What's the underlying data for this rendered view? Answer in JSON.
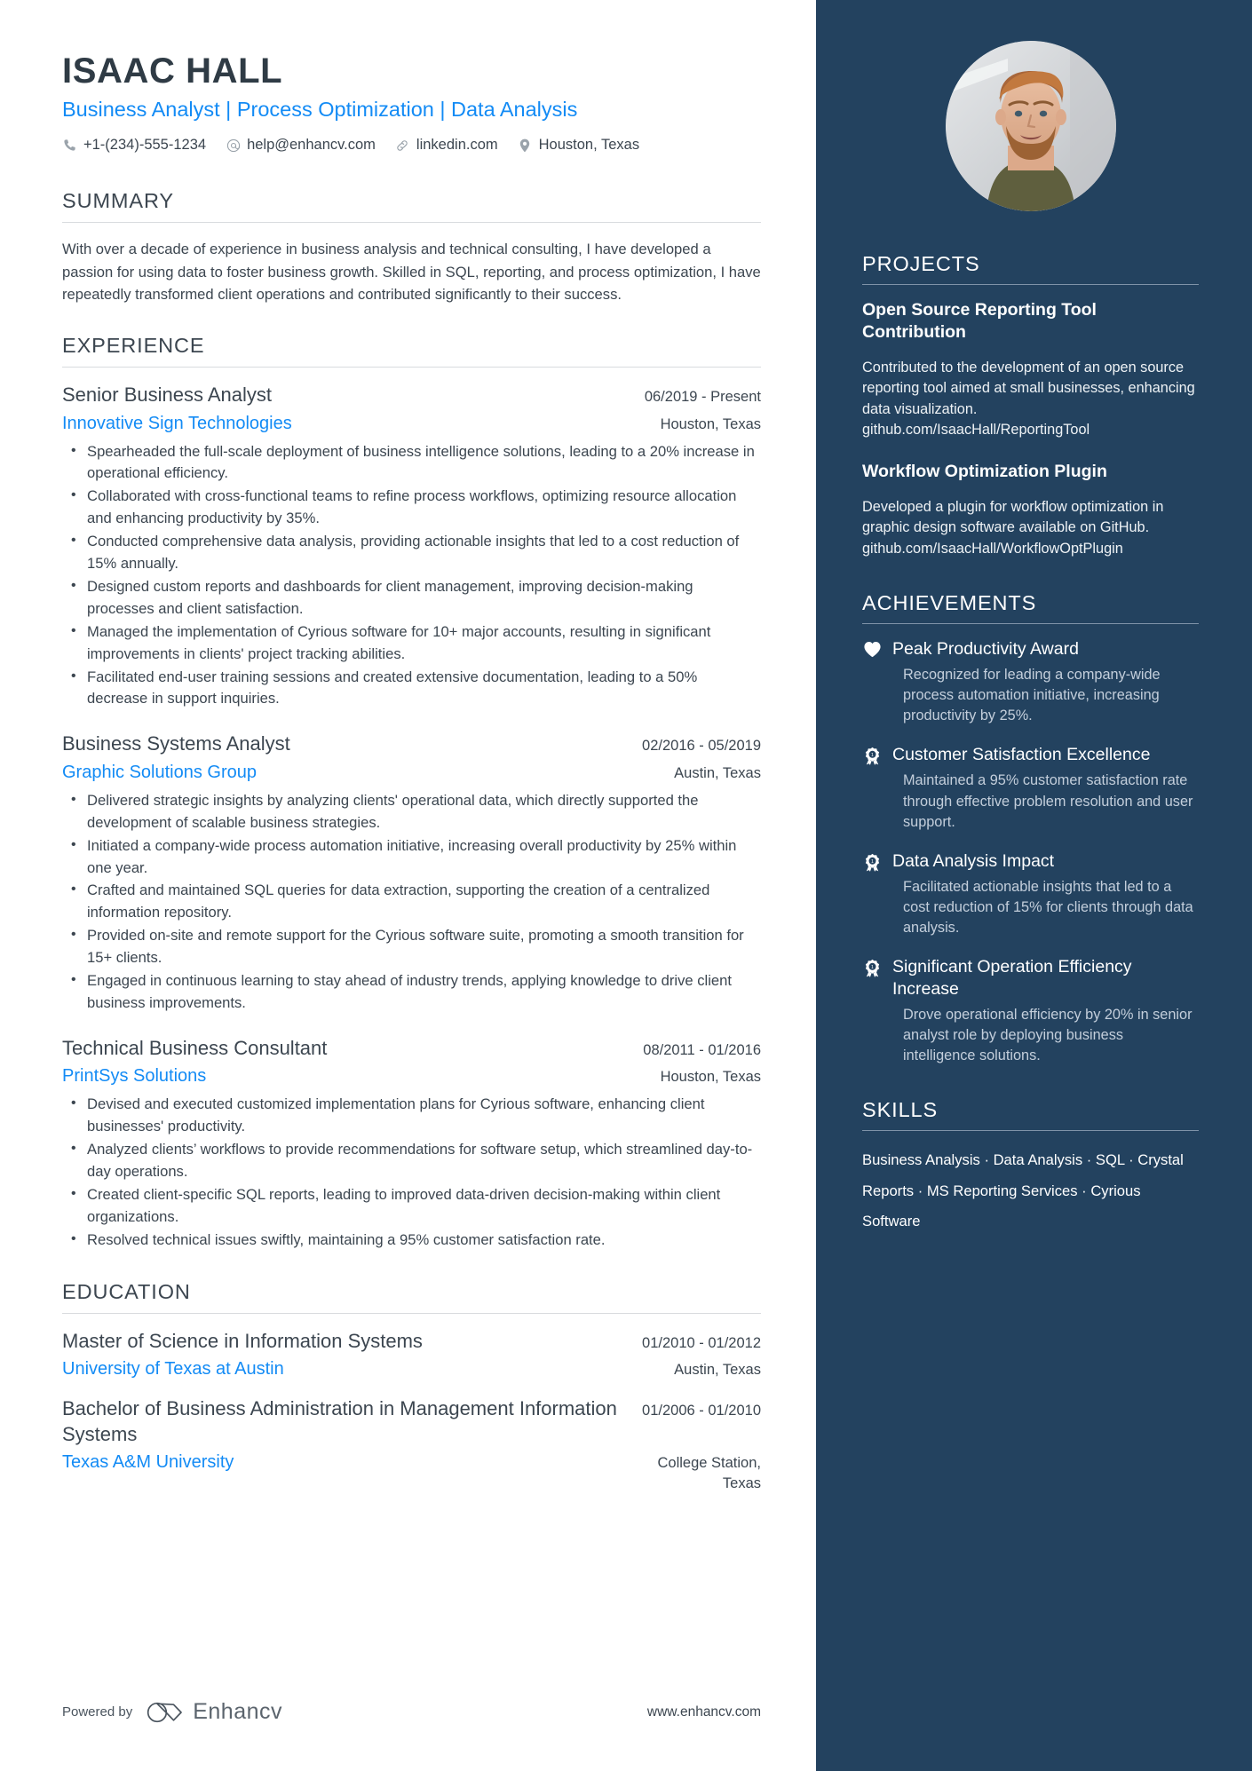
{
  "header": {
    "name": "ISAAC HALL",
    "headline": "Business Analyst | Process Optimization | Data Analysis",
    "contacts": [
      {
        "icon": "phone-icon",
        "text": "+1-(234)-555-1234"
      },
      {
        "icon": "email-icon",
        "text": "help@enhancv.com"
      },
      {
        "icon": "link-icon",
        "text": "linkedin.com"
      },
      {
        "icon": "location-pin-icon",
        "text": "Houston, Texas"
      }
    ]
  },
  "summary": {
    "heading": "SUMMARY",
    "text": "With over a decade of experience in business analysis and technical consulting, I have developed a passion for using data to foster business growth. Skilled in SQL, reporting, and process optimization, I have repeatedly transformed client operations and contributed significantly to their success."
  },
  "experience": {
    "heading": "EXPERIENCE",
    "entries": [
      {
        "title": "Senior Business Analyst",
        "date": "06/2019 - Present",
        "org": "Innovative Sign Technologies",
        "location": "Houston, Texas",
        "bullets": [
          "Spearheaded the full-scale deployment of business intelligence solutions, leading to a 20% increase in operational efficiency.",
          "Collaborated with cross-functional teams to refine process workflows, optimizing resource allocation and enhancing productivity by 35%.",
          "Conducted comprehensive data analysis, providing actionable insights that led to a cost reduction of 15% annually.",
          "Designed custom reports and dashboards for client management, improving decision-making processes and client satisfaction.",
          "Managed the implementation of Cyrious software for 10+ major accounts, resulting in significant improvements in clients' project tracking abilities.",
          "Facilitated end-user training sessions and created extensive documentation, leading to a 50% decrease in support inquiries."
        ]
      },
      {
        "title": "Business Systems Analyst",
        "date": "02/2016 - 05/2019",
        "org": "Graphic Solutions Group",
        "location": "Austin, Texas",
        "bullets": [
          "Delivered strategic insights by analyzing clients' operational data, which directly supported the development of scalable business strategies.",
          "Initiated a company-wide process automation initiative, increasing overall productivity by 25% within one year.",
          "Crafted and maintained SQL queries for data extraction, supporting the creation of a centralized information repository.",
          "Provided on-site and remote support for the Cyrious software suite, promoting a smooth transition for 15+ clients.",
          "Engaged in continuous learning to stay ahead of industry trends, applying knowledge to drive client business improvements."
        ]
      },
      {
        "title": "Technical Business Consultant",
        "date": "08/2011 - 01/2016",
        "org": "PrintSys Solutions",
        "location": "Houston, Texas",
        "bullets": [
          "Devised and executed customized implementation plans for Cyrious software, enhancing client businesses' productivity.",
          "Analyzed clients’ workflows to provide recommendations for software setup, which streamlined day-to-day operations.",
          "Created client-specific SQL reports, leading to improved data-driven decision-making within client organizations.",
          "Resolved technical issues swiftly, maintaining a 95% customer satisfaction rate."
        ]
      }
    ]
  },
  "education": {
    "heading": "EDUCATION",
    "entries": [
      {
        "title": "Master of Science in Information Systems",
        "date": "01/2010 - 01/2012",
        "org": "University of Texas at Austin",
        "location": "Austin, Texas"
      },
      {
        "title": "Bachelor of Business Administration in Management Information Systems",
        "date": "01/2006 - 01/2010",
        "org": "Texas A&M University",
        "location": "College Station, Texas"
      }
    ]
  },
  "footer": {
    "powered_by": "Powered by",
    "brand": "Enhancv",
    "url": "www.enhancv.com"
  },
  "sidebar": {
    "photo_alt": "portrait-photo",
    "projects": {
      "heading": "PROJECTS",
      "items": [
        {
          "title": "Open Source Reporting Tool Contribution",
          "description": "Contributed to the development of an open source reporting tool aimed at small businesses, enhancing data visualization. github.com/IsaacHall/ReportingTool"
        },
        {
          "title": "Workflow Optimization Plugin",
          "description": "Developed a plugin for workflow optimization in graphic design software available on GitHub. github.com/IsaacHall/WorkflowOptPlugin"
        }
      ]
    },
    "achievements": {
      "heading": "ACHIEVEMENTS",
      "items": [
        {
          "icon": "heart-icon",
          "title": "Peak Productivity Award",
          "description": "Recognized for leading a company-wide process automation initiative, increasing productivity by 25%."
        },
        {
          "icon": "award-ribbon-icon",
          "title": "Customer Satisfaction Excellence",
          "description": "Maintained a 95% customer satisfaction rate through effective problem resolution and user support."
        },
        {
          "icon": "award-ribbon-icon",
          "title": "Data Analysis Impact",
          "description": "Facilitated actionable insights that led to a cost reduction of 15% for clients through data analysis."
        },
        {
          "icon": "award-ribbon-icon",
          "title": "Significant Operation Efficiency Increase",
          "description": "Drove operational efficiency by 20% in senior analyst role by deploying business intelligence solutions."
        }
      ]
    },
    "skills": {
      "heading": "SKILLS",
      "separator": "·",
      "items": [
        "Business Analysis",
        "Data Analysis",
        "SQL",
        "Crystal Reports",
        "MS Reporting Services",
        "Cyrious Software"
      ]
    }
  },
  "colors": {
    "sidebar_bg": "#23425f",
    "accent_blue": "#138bf5",
    "body_text": "#3c4650"
  }
}
